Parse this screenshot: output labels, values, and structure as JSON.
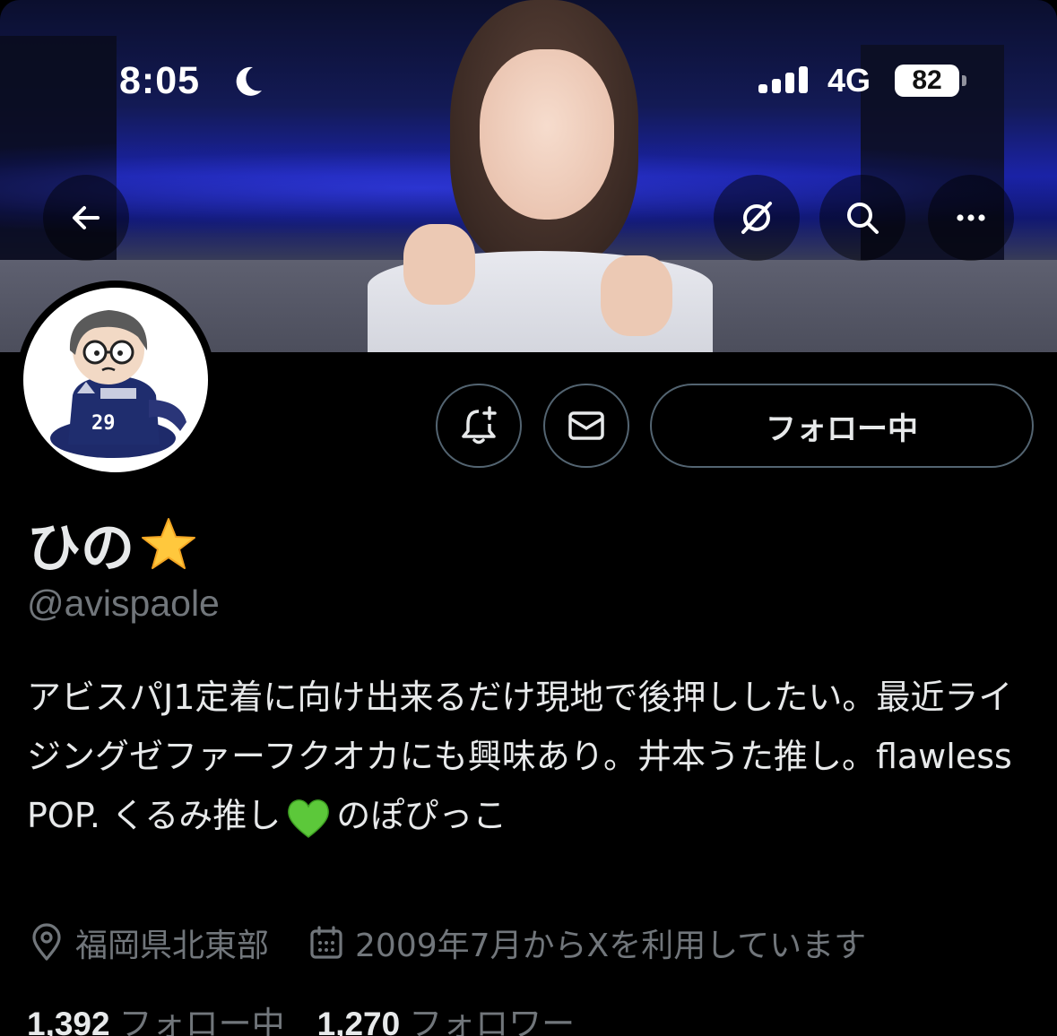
{
  "status_bar": {
    "time": "8:05",
    "network": "4G",
    "battery": "82"
  },
  "nav": {
    "back_icon": "arrow-left-icon",
    "grok_icon": "grok-icon",
    "search_icon": "search-icon",
    "more_icon": "more-horizontal-icon"
  },
  "actions": {
    "notify_icon": "bell-plus-icon",
    "message_icon": "envelope-icon",
    "follow_label": "フォロー中"
  },
  "profile": {
    "name": "ひの",
    "name_emoji": "star",
    "handle": "@avispaole",
    "bio_part1": "アビスパJ1定着に向け出来るだけ現地で後押ししたい。最近ライジングゼファーフクオカにも興味あり。井本うた推し。flawless POP. くるみ推し",
    "bio_emoji": "green-heart",
    "bio_part2": "のぽぴっこ",
    "location": "福岡県北東部",
    "joined": "2009年7月からXを利用しています"
  },
  "stats": {
    "following_count": "1,392",
    "following_label": "フォロー中",
    "followers_count": "1,270",
    "followers_label": "フォロワー"
  },
  "colors": {
    "background": "#000000",
    "primary_text": "#e7e9ea",
    "secondary_text": "#71767b",
    "border": "#536471"
  }
}
